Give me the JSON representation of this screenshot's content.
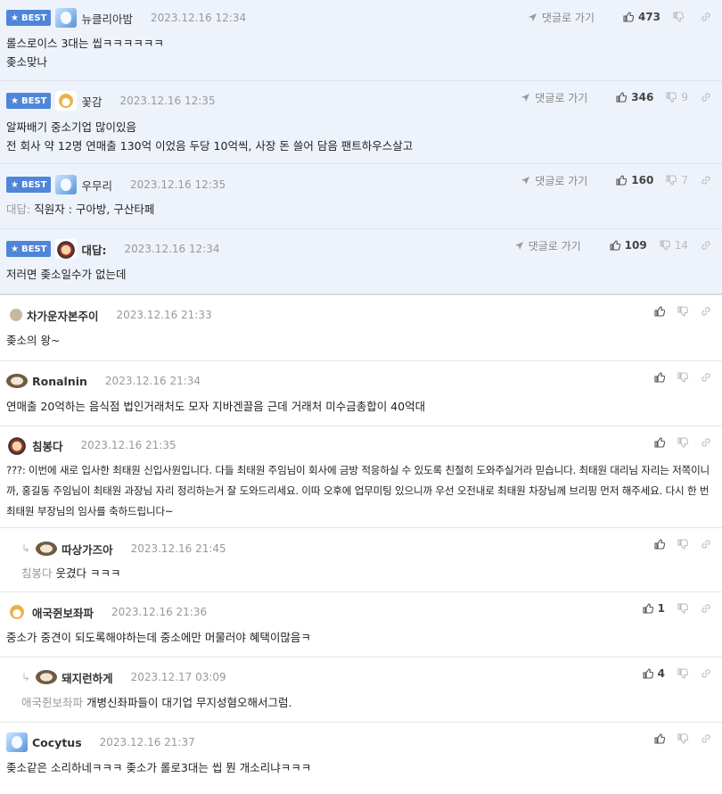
{
  "best_label": "BEST",
  "reply_link_label": "댓글로 가기",
  "comments": [
    {
      "nick": "뉴클리아밤",
      "time": "2023.12.16 12:34",
      "lines": [
        "롤스로이스 3대는 씹ㅋㅋㅋㅋㅋㅋ",
        "좆소맞나"
      ],
      "up": "473",
      "down": ""
    },
    {
      "nick": "꽃감",
      "time": "2023.12.16 12:35",
      "lines": [
        "알짜배기 중소기업 많이있음",
        "전 회사 약 12명 연매출 130억 이었음 두당 10억씩, 사장 돈 쓸어 담음 팬트하우스살고"
      ],
      "up": "346",
      "down": "9"
    },
    {
      "nick": "우무리",
      "time": "2023.12.16 12:35",
      "quote": "대답:",
      "text": "직원자 : 구아방, 구산타페",
      "up": "160",
      "down": "7"
    },
    {
      "nick": "대답:",
      "time": "2023.12.16 12:34",
      "lines": [
        "저러면 좆소일수가 없는데"
      ],
      "up": "109",
      "down": "14"
    },
    {
      "nick": "차가운자본주이",
      "time": "2023.12.16 21:33",
      "lines": [
        "좆소의 왕~"
      ]
    },
    {
      "nick": "Ronalnin",
      "time": "2023.12.16 21:34",
      "lines": [
        "연매출 20억하는 음식점 법인거래처도 모자 지바겐끌음 근데 거래처 미수금총합이 40억대"
      ]
    },
    {
      "nick": "침봉다",
      "time": "2023.12.16 21:35",
      "lines": [
        "???: 이번에 새로 입사한 최태원 신입사원입니다. 다들 최태원 주임님이 회사에 금방 적응하실 수 있도록 친절히 도와주실거라 믿습니다. 최태원 대리님 자리는 저쪽이니까, 홍길동 주임님이 최태원 과장님 자리 정리하는거 잘 도와드리세요. 이따 오후에 업무미팅 있으니까 우선 오전내로 최태원 차장님께 브리핑 먼저 해주세요. 다시 한 번 최태원 부장님의 임사를 축하드립니다~"
      ]
    },
    {
      "nick": "따상가즈아",
      "time": "2023.12.16 21:45",
      "quote": "침봉다",
      "text": "웃겼다 ㅋㅋㅋ"
    },
    {
      "nick": "애국쥔보좌파",
      "time": "2023.12.16 21:36",
      "lines": [
        "중소가 중견이 되도록해야하는데 중소에만 머물러야 혜택이많음ㅋ"
      ],
      "up": "1"
    },
    {
      "nick": "돼지런하게",
      "time": "2023.12.17 03:09",
      "quote": "애국쥔보좌파",
      "text": "개병신좌파들이 대기업 무지성혐오해서그럼.",
      "up": "4"
    },
    {
      "nick": "Cocytus",
      "time": "2023.12.16 21:37",
      "lines": [
        "좆소같은 소리하네ㅋㅋㅋ 좆소가 롤로3대는 씹 뭔 개소리냐ㅋㅋㅋ"
      ]
    }
  ]
}
